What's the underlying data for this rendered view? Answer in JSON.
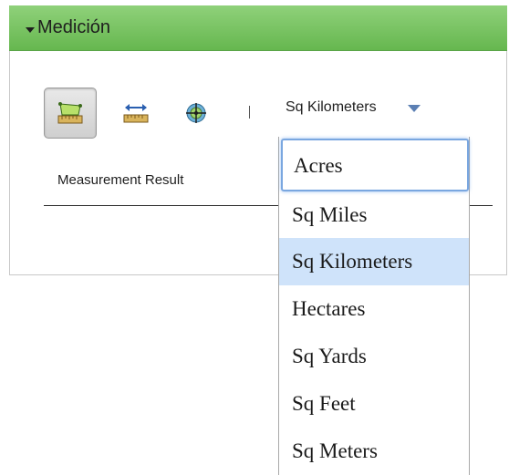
{
  "panel": {
    "title": "Medición",
    "header_color": "#6fbf57"
  },
  "toolbar": {
    "tools": [
      {
        "icon": "area-measure-icon",
        "active": true
      },
      {
        "icon": "distance-measure-icon",
        "active": false
      },
      {
        "icon": "location-icon",
        "active": false
      }
    ],
    "unit_selected": "Sq Kilometers"
  },
  "result": {
    "label": "Measurement Result"
  },
  "dropdown": {
    "options": [
      "Acres",
      "Sq Miles",
      "Sq Kilometers",
      "Hectares",
      "Sq Yards",
      "Sq Feet",
      "Sq Meters"
    ],
    "focused_option": "Acres",
    "highlighted_option": "Sq Kilometers",
    "highlight_color": "#cfe3fa",
    "focus_color": "#7aa7e0"
  }
}
